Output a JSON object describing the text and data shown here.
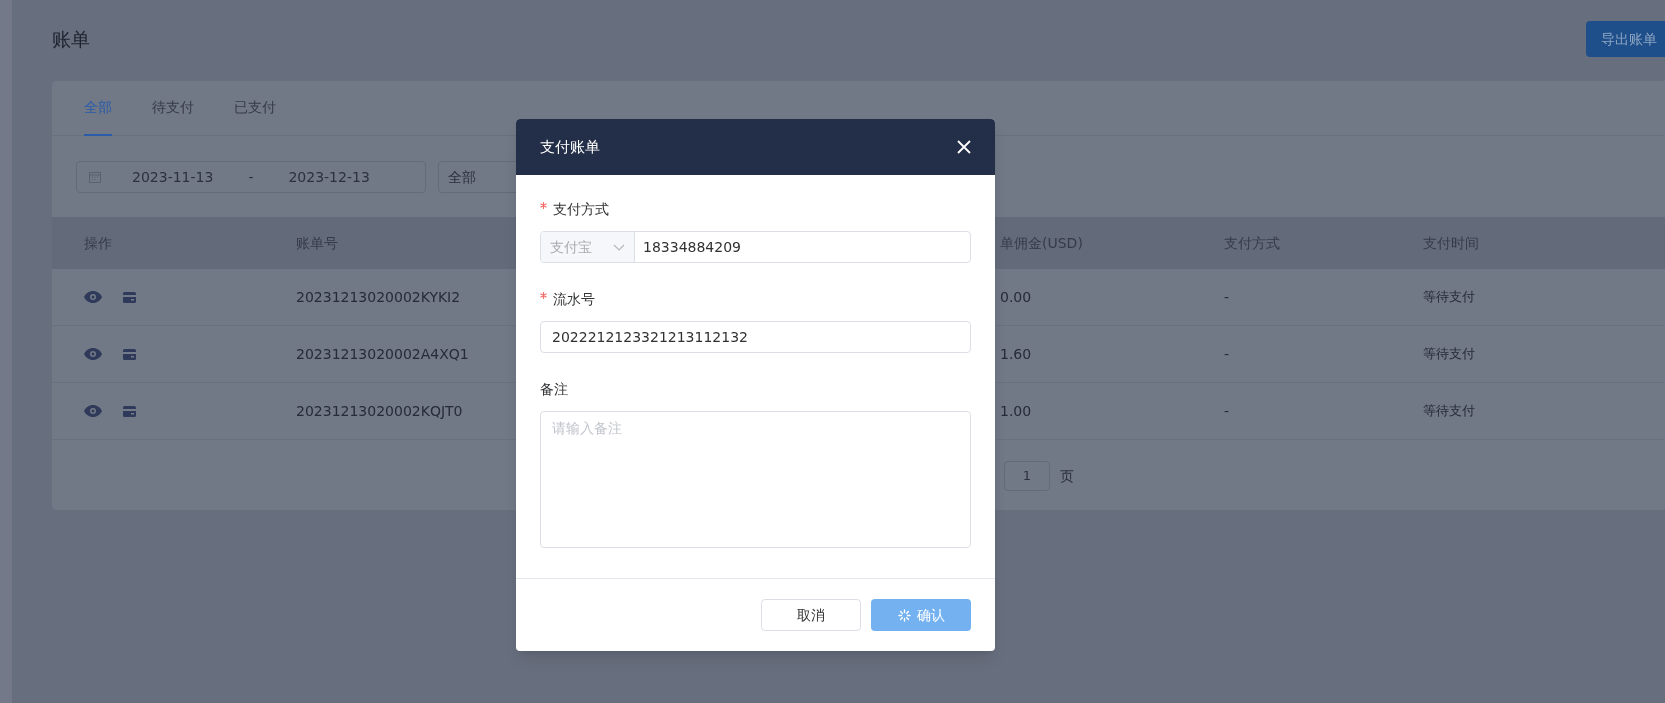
{
  "page": {
    "title": "账单",
    "export_button": "导出账单"
  },
  "tabs": [
    {
      "label": "全部",
      "selected": true
    },
    {
      "label": "待支付",
      "selected": false
    },
    {
      "label": "已支付",
      "selected": false
    }
  ],
  "filters": {
    "date_start": "2023-11-13",
    "date_separator": "-",
    "date_end": "2023-12-13",
    "status_select": "全部"
  },
  "table": {
    "columns": [
      "操作",
      "账单号",
      "单佣金(USD)",
      "支付方式",
      "支付时间"
    ],
    "rows": [
      {
        "bill_no": "20231213020002KYKI2",
        "commission": "0.00",
        "payment_method": "-",
        "payment_time": "等待支付"
      },
      {
        "bill_no": "20231213020002A4XQ1",
        "commission": "1.60",
        "payment_method": "-",
        "payment_time": "等待支付"
      },
      {
        "bill_no": "20231213020002KQJT0",
        "commission": "1.00",
        "payment_method": "-",
        "payment_time": "等待支付"
      }
    ]
  },
  "pagination": {
    "page_input": "1",
    "page_unit": "页"
  },
  "dialog": {
    "title": "支付账单",
    "fields": [
      {
        "kind": "method",
        "label": "支付方式",
        "required": true,
        "select": "支付宝",
        "value": "18334884209"
      },
      {
        "kind": "text",
        "label": "流水号",
        "required": true,
        "value": "2022212123321213112132"
      },
      {
        "kind": "textarea",
        "label": "备注",
        "placeholder": "请输入备注"
      }
    ],
    "buttons": [
      {
        "kind": "cancel",
        "label": "取消"
      },
      {
        "kind": "confirm",
        "label": "确认",
        "loading": true
      }
    ]
  }
}
